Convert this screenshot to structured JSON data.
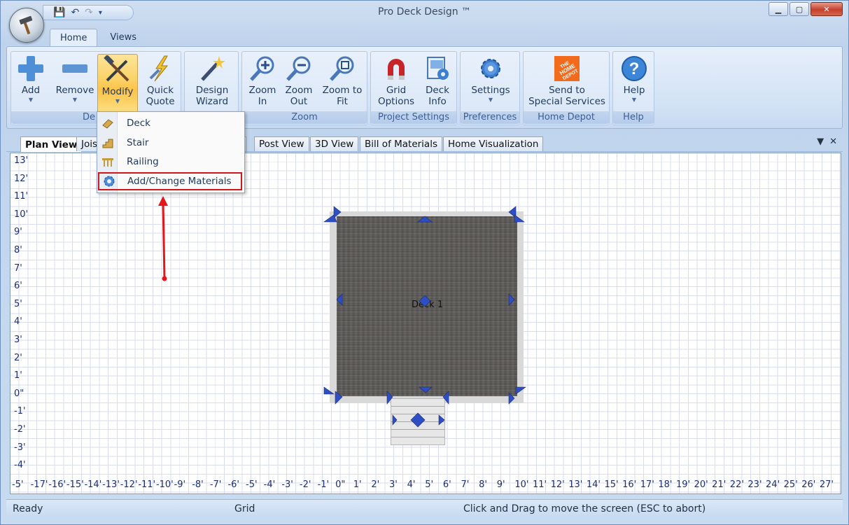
{
  "app": {
    "title": "Pro Deck Design ™"
  },
  "ribbon": {
    "tabs": [
      {
        "label": "Home"
      },
      {
        "label": "Views"
      }
    ],
    "groups": {
      "design": {
        "label": "De",
        "add": "Add",
        "remove": "Remove",
        "modify": "Modify",
        "quick_quote_1": "Quick",
        "quick_quote_2": "Quote",
        "design_wizard_1": "Design",
        "design_wizard_2": "Wizard"
      },
      "zoom": {
        "label": "Zoom",
        "zoom_in_1": "Zoom",
        "zoom_in_2": "In",
        "zoom_out_1": "Zoom",
        "zoom_out_2": "Out",
        "zoom_fit_1": "Zoom to",
        "zoom_fit_2": "Fit"
      },
      "project_settings": {
        "label": "Project Settings",
        "grid_1": "Grid",
        "grid_2": "Options",
        "deck_1": "Deck",
        "deck_2": "Info"
      },
      "preferences": {
        "label": "Preferences",
        "settings": "Settings"
      },
      "home_depot": {
        "label": "Home Depot",
        "send_1": "Send to",
        "send_2": "Special Services",
        "logo_text": "THE HOME DEPOT"
      },
      "help": {
        "label": "Help",
        "help": "Help"
      }
    }
  },
  "modify_menu": {
    "items": [
      {
        "label": "Deck"
      },
      {
        "label": "Stair"
      },
      {
        "label": "Railing"
      },
      {
        "label": "Add/Change Materials"
      }
    ]
  },
  "view_tabs": [
    {
      "label": "Plan View"
    },
    {
      "label": "Jois"
    },
    {
      "label": "w"
    },
    {
      "label": "Post View"
    },
    {
      "label": "3D View"
    },
    {
      "label": "Bill of Materials"
    },
    {
      "label": "Home Visualization"
    }
  ],
  "canvas": {
    "deck_label": "Deck 1",
    "y_labels": [
      "13'",
      "12'",
      "11'",
      "10'",
      "9'",
      "8'",
      "7'",
      "6'",
      "5'",
      "4'",
      "3'",
      "2'",
      "1'",
      "0\"",
      "-1'",
      "-2'",
      "-3'",
      "-4'"
    ],
    "x_labels": [
      "-5'",
      "-17'",
      "-16'",
      "-15'",
      "-14'",
      "-13'",
      "-12'",
      "-11'",
      "-10'",
      "-9'",
      "-8'",
      "-7'",
      "-6'",
      "-5'",
      "-4'",
      "-3'",
      "-2'",
      "-1'",
      "0\"",
      "1'",
      "2'",
      "3'",
      "4'",
      "5'",
      "6'",
      "7'",
      "8'",
      "9'",
      "10'",
      "11'",
      "12'",
      "13'",
      "14'",
      "15'",
      "16'",
      "17'",
      "18'",
      "19'",
      "20'",
      "21'",
      "22'",
      "23'",
      "24'",
      "25'",
      "26'",
      "27'"
    ]
  },
  "status": {
    "left": "Ready",
    "middle": "Grid",
    "right": "Click and Drag to move the screen  (ESC to abort)"
  },
  "colors": {
    "highlight_border": "#d2171a",
    "active_button": "#fcc347",
    "grid_line": "#8f9ccf"
  }
}
